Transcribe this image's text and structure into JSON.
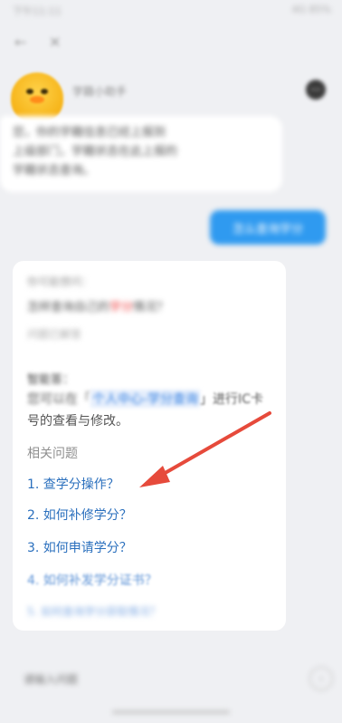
{
  "status": {
    "left": "下午11:11",
    "right": "4G 85%"
  },
  "nav": {
    "back": "←",
    "close": "✕"
  },
  "bot": {
    "name": "学籍小助手",
    "menu": "···"
  },
  "bubble1": {
    "lines": [
      "您，你的学籍信息已经上报到",
      "上级部门，学籍状态在此上报的",
      "学籍状态查询。"
    ]
  },
  "user_message": "怎么查询学分",
  "answer": {
    "q_line1": "你可能想问：",
    "q_line2_before": "怎样查询自己的",
    "q_line2_red": "学分",
    "q_line2_after": "情况？",
    "q_line3": "问题已解答",
    "title": "智能答：",
    "line1_before": "您可以在「",
    "line1_link": "个人中心-学分查询",
    "line1_after": "」进行IC卡",
    "line2": "号的查看与修改。"
  },
  "related": {
    "heading": "相关问题",
    "items": [
      "1. 查学分操作？",
      "2. 如何补修学分？",
      "3. 如何申请学分？",
      "4. 如何补发学分证书？",
      "5. 如何查询学分获取情况？"
    ]
  },
  "input": {
    "placeholder": "请输入问题"
  },
  "send": "›",
  "colors": {
    "accent": "#2f9af0",
    "link": "#2a6fbd",
    "arrow": "#e64a3b"
  }
}
